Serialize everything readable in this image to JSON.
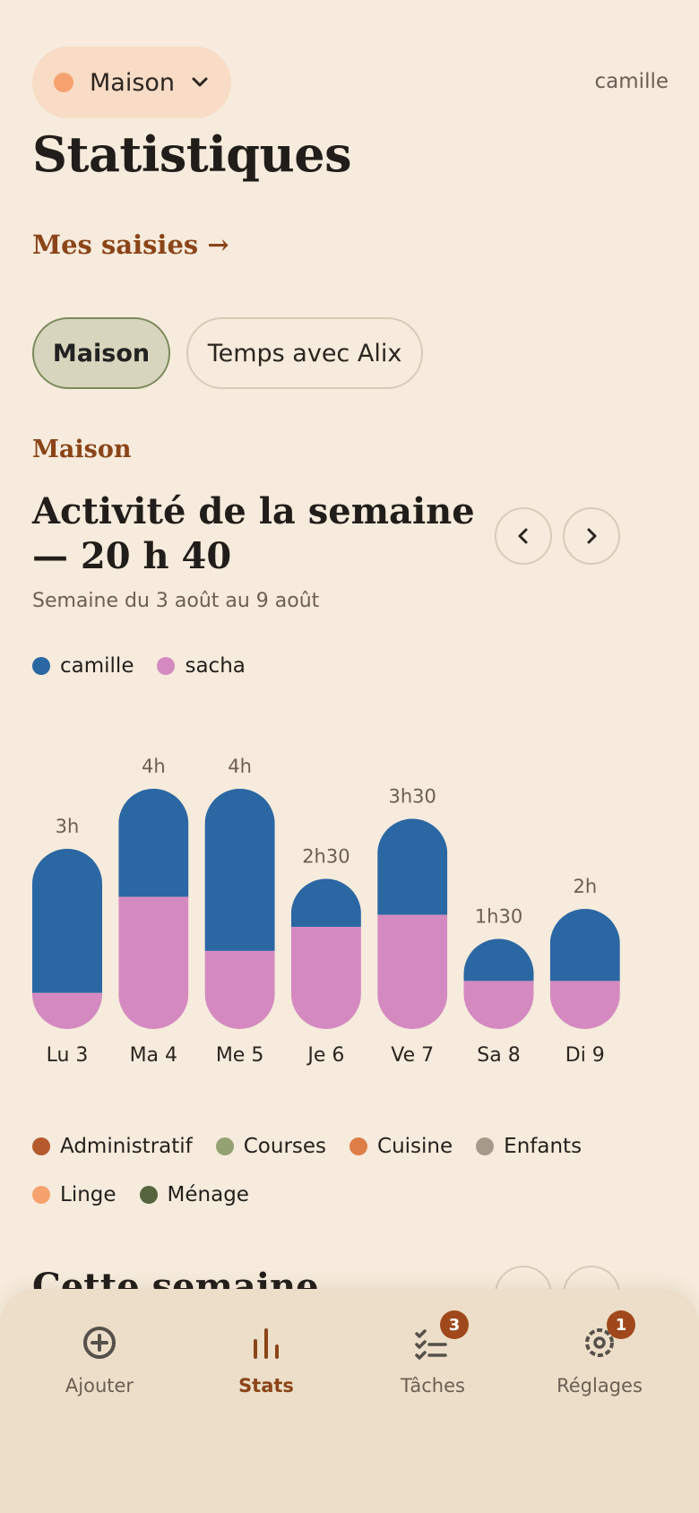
{
  "header": {
    "house_name": "Maison",
    "user": "camille",
    "title": "Statistiques",
    "entries_link": "Mes saisies →"
  },
  "segments": [
    {
      "label": "Maison",
      "active": true
    },
    {
      "label": "Temps avec Alix",
      "active": false
    }
  ],
  "section": {
    "label": "Maison",
    "week_title": "Activité de la semaine — 20 h 40",
    "week_subtitle": "Semaine du 3 août au 9 août"
  },
  "people_legend": [
    {
      "name": "camille",
      "color": "#2a67a3"
    },
    {
      "name": "sacha",
      "color": "#d48ac0"
    }
  ],
  "chart_data": {
    "type": "bar",
    "stacked": true,
    "categories": [
      "Lu 3",
      "Ma 4",
      "Me 5",
      "Je 6",
      "Ve 7",
      "Sa 8",
      "Di 9"
    ],
    "value_labels": [
      "3h",
      "4h",
      "4h",
      "2h30",
      "3h30",
      "1h30",
      "2h"
    ],
    "totals_hours": [
      3,
      4,
      4,
      2.5,
      3.5,
      1.5,
      2
    ],
    "series": [
      {
        "name": "sacha",
        "color": "#d48ac0",
        "values": [
          0.6,
          2.2,
          1.3,
          1.7,
          1.9,
          0.8,
          0.8
        ]
      },
      {
        "name": "camille",
        "color": "#2a67a3",
        "values": [
          2.4,
          1.8,
          2.7,
          0.8,
          1.6,
          0.7,
          1.2
        ]
      }
    ]
  },
  "category_legend": [
    {
      "name": "Administratif",
      "color": "#b55a2c"
    },
    {
      "name": "Courses",
      "color": "#93a173"
    },
    {
      "name": "Cuisine",
      "color": "#dd7e48"
    },
    {
      "name": "Enfants",
      "color": "#a59a8a"
    },
    {
      "name": "Linge",
      "color": "#f6a26f"
    },
    {
      "name": "Ménage",
      "color": "#56653e"
    }
  ],
  "next_section_title": "Cette semaine",
  "tabbar": {
    "add": "Ajouter",
    "stats": "Stats",
    "tasks": "Tâches",
    "tasks_badge": "3",
    "settings": "Réglages",
    "settings_badge": "1"
  }
}
